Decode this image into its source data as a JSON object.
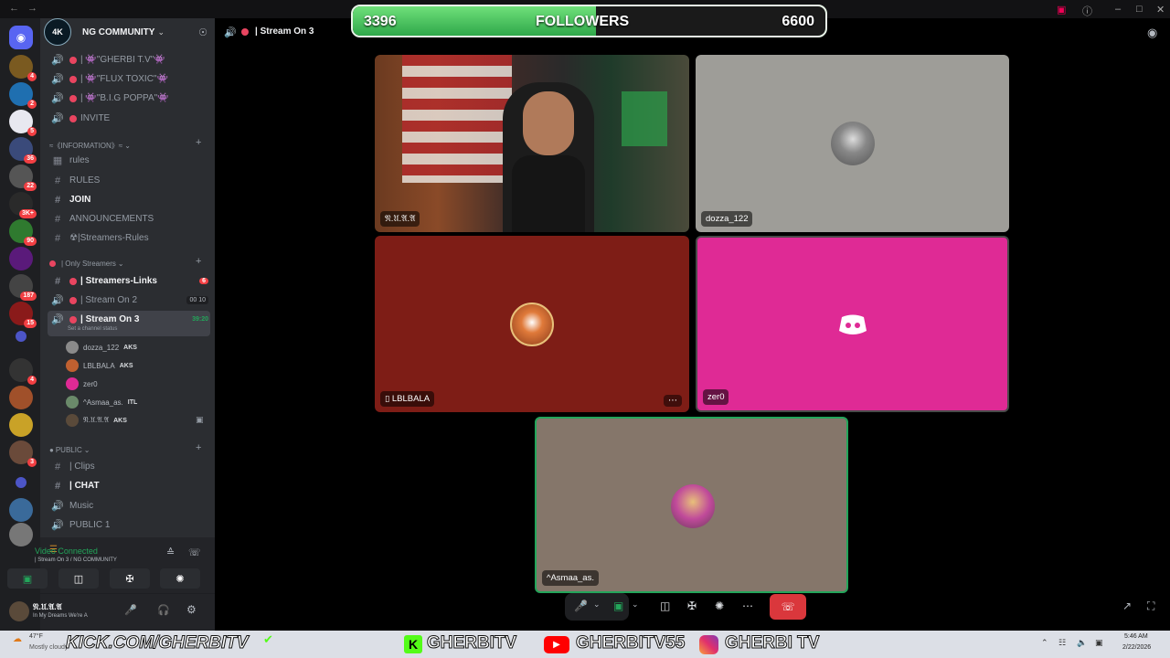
{
  "overlay": {
    "current": "3396",
    "label": "FOLLOWERS",
    "goal": "6600",
    "progress": 0.515
  },
  "header": {
    "channel": "| Stream On 3"
  },
  "server": {
    "name": "NG COMMUNITY",
    "logo_text": "4K"
  },
  "rail_badges": [
    "4",
    "2",
    "5",
    "36",
    "22",
    "3K+",
    "90",
    "187",
    "15",
    "4",
    "3"
  ],
  "channels_top": [
    "| 👾\"GHERBI T.V\"👾",
    "| 👾\"FLUX TOXIC\"👾",
    "| 👾\"B.I.G POPPA\"👾",
    "INVITE"
  ],
  "info_category": "≈《INFORMATION》≈",
  "info_channels": [
    "rules",
    "RULES",
    "JOIN",
    "ANNOUNCEMENTS",
    "☢|Streamers-Rules"
  ],
  "only_category": "| Only Streamers",
  "streamer_channels": [
    {
      "name": "| Streamers-Links",
      "extra": "6"
    },
    {
      "name": "| Stream On 2",
      "extra": "00  10"
    },
    {
      "name": "| Stream On 3",
      "extra": "39:20",
      "status": "Set a channel status"
    }
  ],
  "voice_users": [
    {
      "name": "dozza_122",
      "tag": "AKS"
    },
    {
      "name": "LBLBALA",
      "tag": "AKS"
    },
    {
      "name": "zer0",
      "tag": ""
    },
    {
      "name": "^Asmaa_as.",
      "tag": "ITL"
    },
    {
      "name": "𝔑.𝔘.𝔄.𝔄",
      "tag": "AKS"
    }
  ],
  "public_category": "PUBLIC",
  "public_channels": [
    "| Clips",
    "| CHAT",
    "Music",
    "PUBLIC 1"
  ],
  "voice_panel": {
    "status": "Video Connected",
    "sub": "| Stream On 3 / NG COMMUNITY"
  },
  "user_panel": {
    "name": "𝔑.𝔘.𝔄.𝔄",
    "status": "In My Dreams We're A"
  },
  "tiles": [
    {
      "name": "𝔑.𝔘.𝔄.𝔄",
      "bg": "#5b3a2a"
    },
    {
      "name": "dozza_122",
      "bg": "#9e9d98"
    },
    {
      "name": "LBLBALA",
      "bg": "#7e1d16"
    },
    {
      "name": "zer0",
      "bg": "#df2a95"
    },
    {
      "name": "^Asmaa_as.",
      "bg": "#85766a"
    }
  ],
  "weather": {
    "temp": "47°F",
    "desc": "Mostly cloudy"
  },
  "social": {
    "kick": "KICK.COM/GHERBITV",
    "kick2": "GHERBITV",
    "youtube": "GHERBITV55",
    "instagram": "GHERBI TV"
  },
  "clock": {
    "time": "5:46 AM",
    "date": "2/22/2026"
  }
}
